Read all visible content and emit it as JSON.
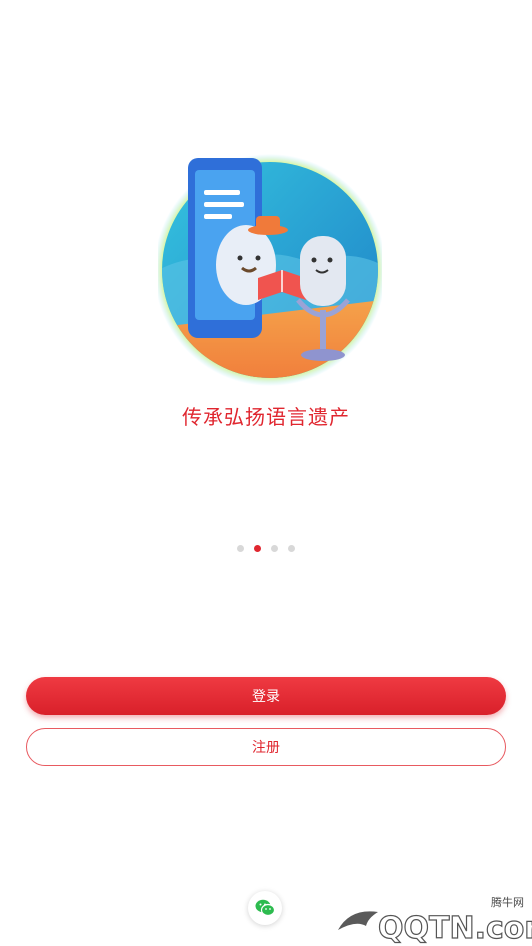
{
  "intro": {
    "tagline": "传承弘扬语言遗产",
    "pager": {
      "count": 4,
      "active_index": 1
    }
  },
  "actions": {
    "login_label": "登录",
    "register_label": "注册"
  },
  "social": {
    "icon": "wechat-icon"
  },
  "watermark": {
    "site_name": "腾牛网",
    "logo_text": "QQTN.com"
  },
  "colors": {
    "accent": "#e0262f",
    "dot_inactive": "#d8d8d8",
    "wechat": "#2dbb4f"
  }
}
